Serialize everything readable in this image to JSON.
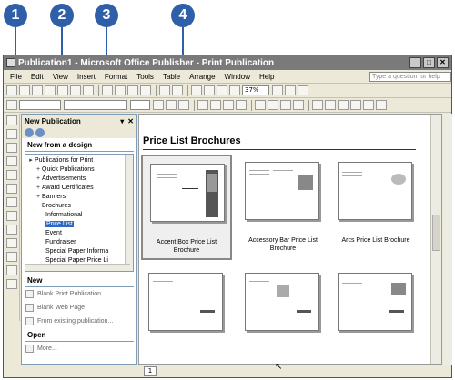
{
  "callouts": [
    "1",
    "2",
    "3",
    "4"
  ],
  "window": {
    "title": "Publication1 - Microsoft Office Publisher - Print Publication",
    "minimize": "_",
    "maximize": "□",
    "close": "✕"
  },
  "menu": {
    "items": [
      "File",
      "Edit",
      "View",
      "Insert",
      "Format",
      "Tools",
      "Table",
      "Arrange",
      "Window",
      "Help"
    ],
    "help_placeholder": "Type a question for help"
  },
  "toolbar": {
    "zoom": "37%"
  },
  "taskpane": {
    "title": "New Publication",
    "section_design": "New from a design",
    "tree": [
      {
        "label": "Publications for Print",
        "exp": "▸",
        "indent": 0
      },
      {
        "label": "Quick Publications",
        "exp": "+",
        "indent": 1
      },
      {
        "label": "Advertisements",
        "exp": "+",
        "indent": 1
      },
      {
        "label": "Award Certificates",
        "exp": "+",
        "indent": 1
      },
      {
        "label": "Banners",
        "exp": "+",
        "indent": 1
      },
      {
        "label": "Brochures",
        "exp": "−",
        "indent": 1
      },
      {
        "label": "Informational",
        "exp": "",
        "indent": 2
      },
      {
        "label": "Price List",
        "exp": "",
        "indent": 2,
        "selected": true
      },
      {
        "label": "Event",
        "exp": "",
        "indent": 2
      },
      {
        "label": "Fundraiser",
        "exp": "",
        "indent": 2
      },
      {
        "label": "Special Paper Informa",
        "exp": "",
        "indent": 2
      },
      {
        "label": "Special Paper Price Li",
        "exp": "",
        "indent": 2
      }
    ],
    "section_new": "New",
    "new_links": [
      "Blank Print Publication",
      "Blank Web Page",
      "From existing publication..."
    ],
    "section_open": "Open",
    "open_links": [
      "More..."
    ]
  },
  "gallery": {
    "title": "Price List Brochures",
    "thumbnails": [
      {
        "label": "Accent Box Price List Brochure",
        "selected": true
      },
      {
        "label": "Accessory Bar Price List Brochure"
      },
      {
        "label": "Arcs Price List Brochure"
      },
      {
        "label": ""
      },
      {
        "label": ""
      },
      {
        "label": ""
      }
    ]
  },
  "status": {
    "page": "1"
  }
}
